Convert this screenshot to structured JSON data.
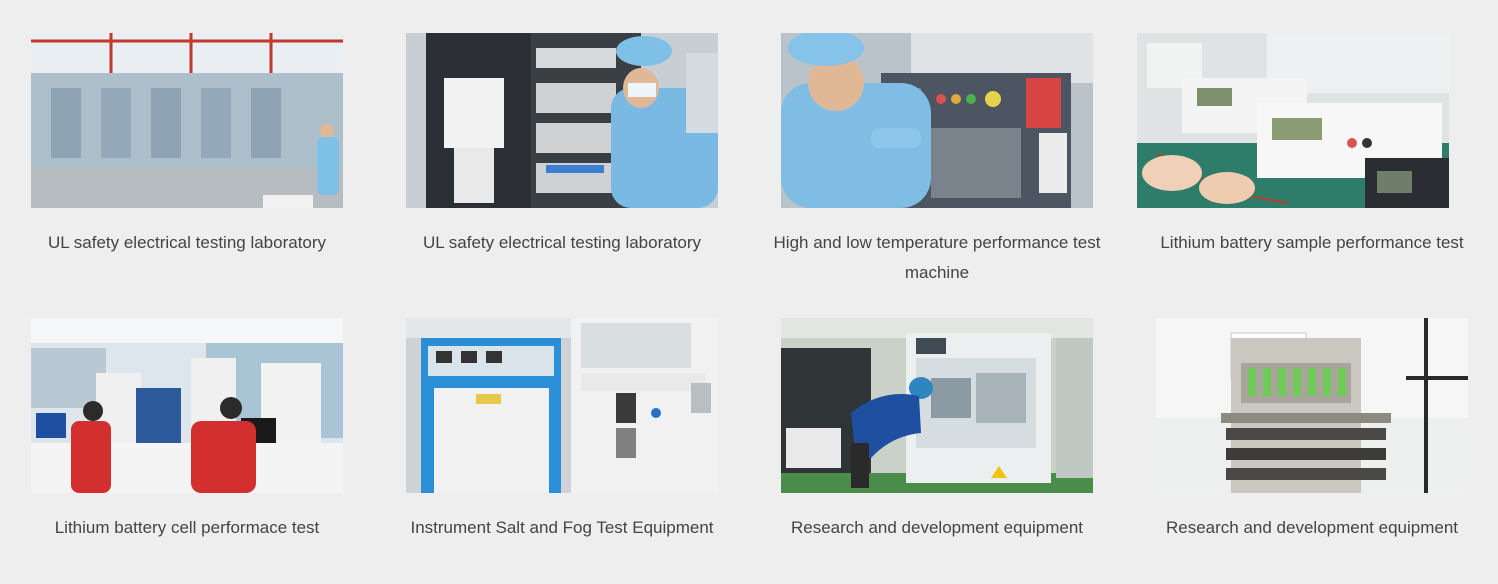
{
  "gallery": {
    "items": [
      {
        "caption": "UL safety electrical testing laboratory",
        "image": "lab-corridor-photo"
      },
      {
        "caption": "UL safety electrical testing laboratory",
        "image": "battery-rack-photo"
      },
      {
        "caption": "High and low temperature performance test machine",
        "image": "temperature-chamber-photo"
      },
      {
        "caption": "Lithium battery sample performance test",
        "image": "bench-instruments-photo"
      },
      {
        "caption": "Lithium battery cell performace test",
        "image": "cell-test-room-photo"
      },
      {
        "caption": "Instrument Salt and Fog Test Equipment",
        "image": "salt-fog-chamber-photo"
      },
      {
        "caption": "Research and development equipment",
        "image": "rd-machine-photo"
      },
      {
        "caption": "Research and development equipment",
        "image": "battery-charger-photo"
      }
    ]
  }
}
